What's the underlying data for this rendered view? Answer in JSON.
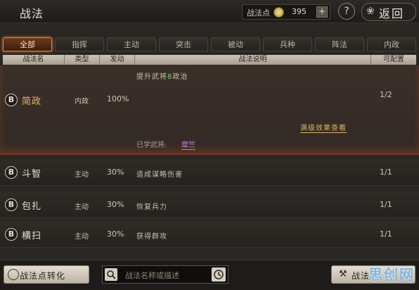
{
  "header": {
    "title": "战法",
    "points_label": "战法点",
    "points_value": "395",
    "plus_label": "+",
    "help_label": "?",
    "back_icon": "swirl-icon",
    "back_label": "返回"
  },
  "tabs": [
    {
      "label": "全部",
      "active": true
    },
    {
      "label": "指挥",
      "active": false
    },
    {
      "label": "主动",
      "active": false
    },
    {
      "label": "突击",
      "active": false
    },
    {
      "label": "被动",
      "active": false
    },
    {
      "label": "兵种",
      "active": false
    },
    {
      "label": "阵法",
      "active": false
    },
    {
      "label": "内政",
      "active": false
    }
  ],
  "columns": [
    "战法名",
    "类型",
    "发动",
    "战法说明",
    "可配置"
  ],
  "selected": {
    "grade": "B",
    "name": "简政",
    "type": "内政",
    "rate": "100%",
    "desc_prefix": "提升武将",
    "desc_value": "8",
    "desc_suffix": "政治",
    "available": "1/2",
    "full_effect_label": "满级效果查看",
    "learned_label": "已学武将:",
    "learned_general": "糜竺"
  },
  "rows": [
    {
      "grade": "B",
      "name": "斗智",
      "type": "主动",
      "rate": "30%",
      "desc": "造成谋略伤害",
      "available": "1/1"
    },
    {
      "grade": "B",
      "name": "包扎",
      "type": "主动",
      "rate": "30%",
      "desc": "恢复兵力",
      "available": "1/1"
    },
    {
      "grade": "B",
      "name": "横扫",
      "type": "主动",
      "rate": "30%",
      "desc": "获得群攻",
      "available": "1/1"
    }
  ],
  "bottom": {
    "convert_label": "战法点转化",
    "search_placeholder": "战法名称或描述",
    "learn_label": "战法"
  },
  "watermark": "思创网"
}
